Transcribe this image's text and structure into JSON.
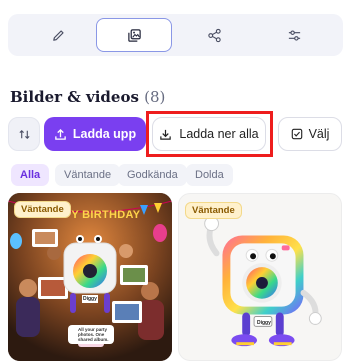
{
  "toolbar": {
    "tools": [
      {
        "icon": "pencil-icon"
      },
      {
        "icon": "images-icon",
        "active": true
      },
      {
        "icon": "share-icon"
      },
      {
        "icon": "sliders-icon"
      }
    ]
  },
  "section": {
    "title": "Bilder & videos",
    "count": "(8)"
  },
  "actions": {
    "sort_icon": "sort-arrows-icon",
    "upload_label": "Ladda upp",
    "download_all_label": "Ladda ner alla",
    "select_label": "Välj"
  },
  "filters": [
    {
      "label": "Alla",
      "active": true
    },
    {
      "label": "Väntande"
    },
    {
      "label": "Godkända"
    },
    {
      "label": "Dolda"
    }
  ],
  "cards": [
    {
      "status": "Väntande",
      "banner": "HAPPY BIRTHDAY",
      "caption": "All your party photos. One shared album.",
      "mascot_tag": "Diggy"
    },
    {
      "status": "Väntande",
      "mascot_tag": "Diggy"
    }
  ],
  "colors": {
    "accent": "#7a3ff0",
    "highlight": "#ee1d1d",
    "badge_bg": "#fff1cc"
  }
}
